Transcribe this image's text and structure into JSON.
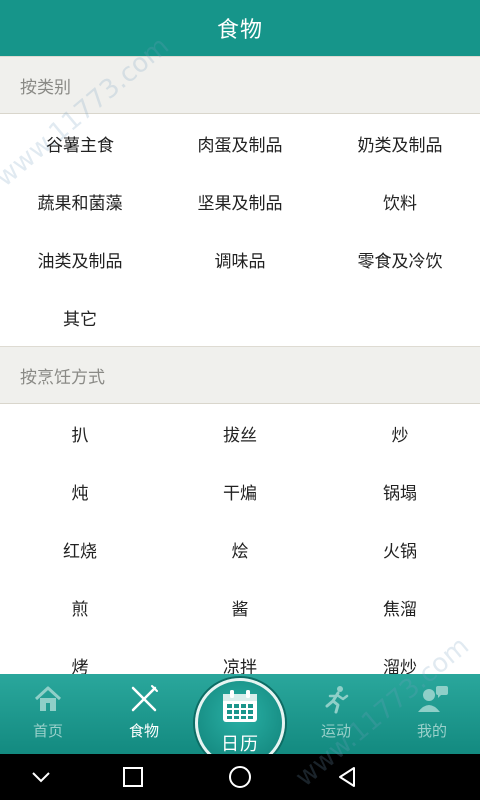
{
  "header": {
    "title": "食物"
  },
  "sections": [
    {
      "title": "按类别",
      "items": [
        "谷薯主食",
        "肉蛋及制品",
        "奶类及制品",
        "蔬果和菌藻",
        "坚果及制品",
        "饮料",
        "油类及制品",
        "调味品",
        "零食及冷饮",
        "其它"
      ]
    },
    {
      "title": "按烹饪方式",
      "items": [
        "扒",
        "拔丝",
        "炒",
        "炖",
        "干煸",
        "锅塌",
        "红烧",
        "烩",
        "火锅",
        "煎",
        "酱",
        "焦溜",
        "烤",
        "凉拌",
        "溜炒"
      ]
    }
  ],
  "tabbar": {
    "home": "首页",
    "food": "食物",
    "calendar": "日历",
    "sport": "运动",
    "mine": "我的"
  },
  "watermark": "www.11773.com",
  "colors": {
    "accent": "#16958a",
    "section_bg": "#f0f0ed",
    "tab_dim": "#9ad1cb"
  }
}
